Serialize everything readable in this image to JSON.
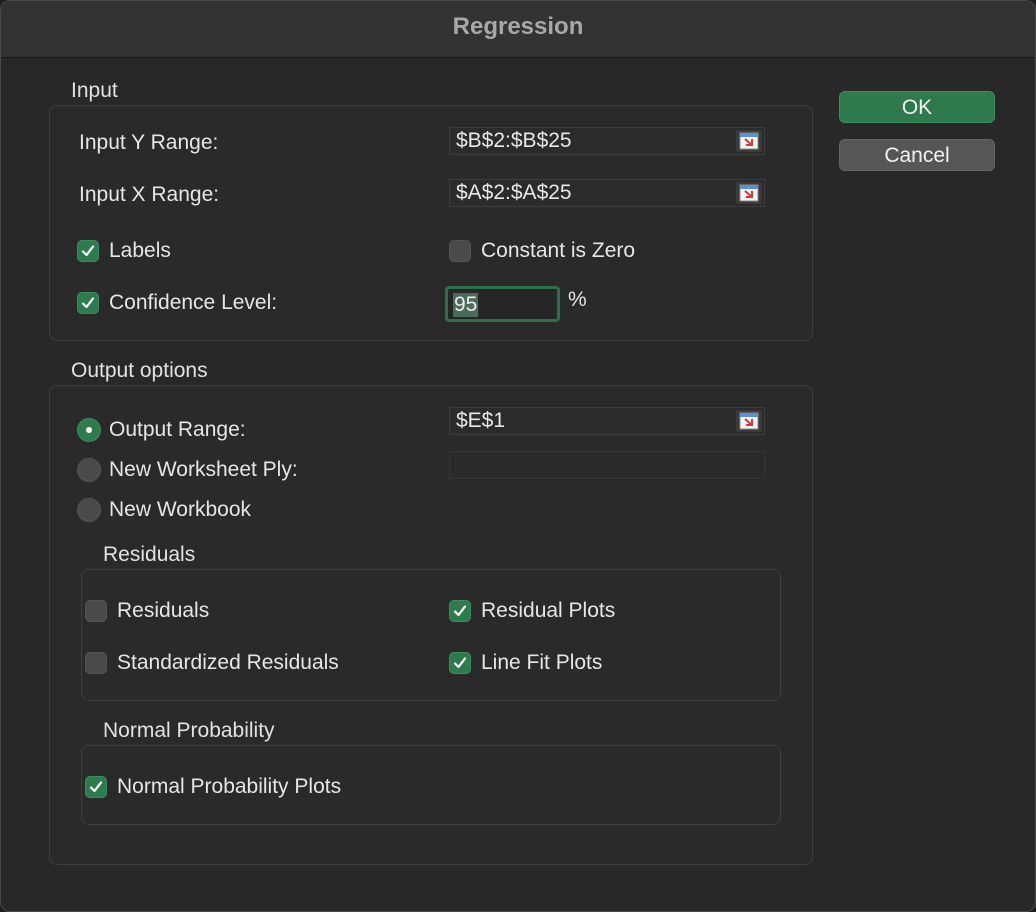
{
  "dialog": {
    "title": "Regression"
  },
  "buttons": {
    "ok": "OK",
    "cancel": "Cancel"
  },
  "input": {
    "section": "Input",
    "y_range_label": "Input Y Range:",
    "y_range_value": "$B$2:$B$25",
    "x_range_label": "Input X Range:",
    "x_range_value": "$A$2:$A$25",
    "labels_label": "Labels",
    "labels_checked": true,
    "constant_zero_label": "Constant is Zero",
    "constant_zero_checked": false,
    "confidence_label": "Confidence Level:",
    "confidence_checked": true,
    "confidence_value": "95",
    "percent": "%"
  },
  "output": {
    "section": "Output options",
    "output_range_label": "Output Range:",
    "output_range_value": "$E$1",
    "new_worksheet_label": "New Worksheet Ply:",
    "new_worksheet_value": "",
    "new_workbook_label": "New Workbook",
    "selected_option": "Output Range"
  },
  "residuals": {
    "section": "Residuals",
    "residuals_label": "Residuals",
    "residuals_checked": false,
    "residual_plots_label": "Residual Plots",
    "residual_plots_checked": true,
    "standardized_label": "Standardized Residuals",
    "standardized_checked": false,
    "line_fit_label": "Line Fit Plots",
    "line_fit_checked": true
  },
  "normal_probability": {
    "section": "Normal Probability",
    "plots_label": "Normal Probability Plots",
    "plots_checked": true
  },
  "colors": {
    "accent": "#2e7a4c",
    "background": "#282828",
    "title": "#a8a8a8"
  },
  "icons": {
    "collapse": "range-collapse-icon",
    "check": "checkmark-icon"
  }
}
